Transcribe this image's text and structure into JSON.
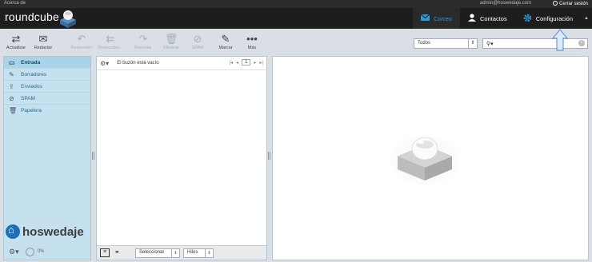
{
  "topline": {
    "about": "Acerca de",
    "user": "admin@hoswedaje.com",
    "logout": "Cerrar sesión"
  },
  "header": {
    "logo": "roundcube"
  },
  "tasks": [
    {
      "label": "Correo",
      "icon": "envelope-icon"
    },
    {
      "label": "Contactos",
      "icon": "person-icon"
    },
    {
      "label": "Configuración",
      "icon": "gear-icon"
    }
  ],
  "toolbar": {
    "refresh": "Actualizar",
    "compose": "Redactar",
    "reply": "Responder",
    "reply_all": "Responder...",
    "forward": "Reenviar",
    "delete": "Eliminar",
    "spam": "SPAM",
    "mark": "Marcar",
    "more": "Más"
  },
  "filter": {
    "value": "Todos"
  },
  "search": {
    "placeholder": ""
  },
  "folders": [
    {
      "label": "Entrada",
      "icon": "inbox-icon",
      "active": true
    },
    {
      "label": "Borradores",
      "icon": "pencil-icon",
      "active": false
    },
    {
      "label": "Enviados",
      "icon": "sent-icon",
      "active": false
    },
    {
      "label": "SPAM",
      "icon": "spam-icon",
      "active": false
    },
    {
      "label": "Papelera",
      "icon": "trash-icon",
      "active": false
    }
  ],
  "brand": {
    "name": "hoswedaje"
  },
  "quota": {
    "text": "0%"
  },
  "list": {
    "status": "El buzón está vacío",
    "page": "1"
  },
  "listfoot": {
    "select": "Seleccionar",
    "threads": "Hilos"
  },
  "colors": {
    "accent": "#2b9ad5",
    "sidebar": "#c5e0ee",
    "header": "#1d1d1d"
  }
}
